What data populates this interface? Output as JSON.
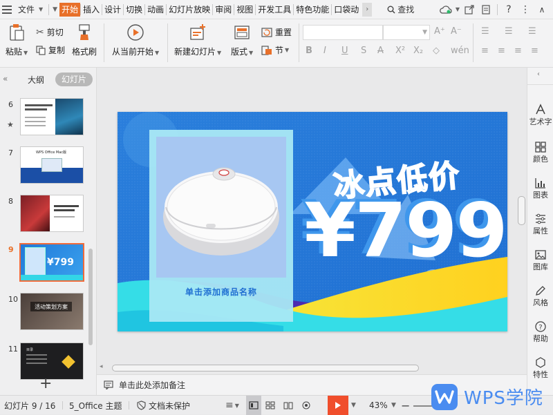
{
  "menubar": {
    "file": "文件",
    "tabs": [
      "开始",
      "插入",
      "设计",
      "切换",
      "动画",
      "幻灯片放映",
      "审阅",
      "视图",
      "开发工具",
      "特色功能",
      "口袋动"
    ],
    "active_tab": "开始",
    "search": "查找"
  },
  "ribbon": {
    "paste": "粘贴",
    "cut": "剪切",
    "copy": "复制",
    "format_painter": "格式刷",
    "play_from_current": "从当前开始",
    "new_slide": "新建幻灯片",
    "layout": "版式",
    "reset": "重置",
    "section": "节"
  },
  "left_panel": {
    "tab_outline": "大纲",
    "tab_slides": "幻灯片",
    "slides": [
      {
        "num": "6",
        "starred": true
      },
      {
        "num": "7",
        "thumb_title": "WPS Office Mac版"
      },
      {
        "num": "8"
      },
      {
        "num": "9",
        "active": true,
        "thumb_price": "¥799"
      },
      {
        "num": "10",
        "thumb_title": "活动策划方案"
      },
      {
        "num": "11",
        "thumb_title": "目录"
      }
    ]
  },
  "slide": {
    "headline": "冰点低价",
    "price": "¥799",
    "product_placeholder": "单击添加商品名称"
  },
  "notes": {
    "placeholder": "单击此处添加备注"
  },
  "right_sidebar": [
    "艺术字",
    "颜色",
    "图表",
    "属性",
    "图库",
    "风格",
    "帮助",
    "特性"
  ],
  "status": {
    "slide_info": "幻灯片 9 / 16",
    "theme": "5_Office 主题",
    "protection": "文档未保护",
    "zoom": "43%"
  },
  "watermark": {
    "text": "WPS学院"
  },
  "colors": {
    "accent": "#e8702a",
    "slide_blue": "#2e86e0",
    "wps_blue": "#4a8cf0"
  }
}
